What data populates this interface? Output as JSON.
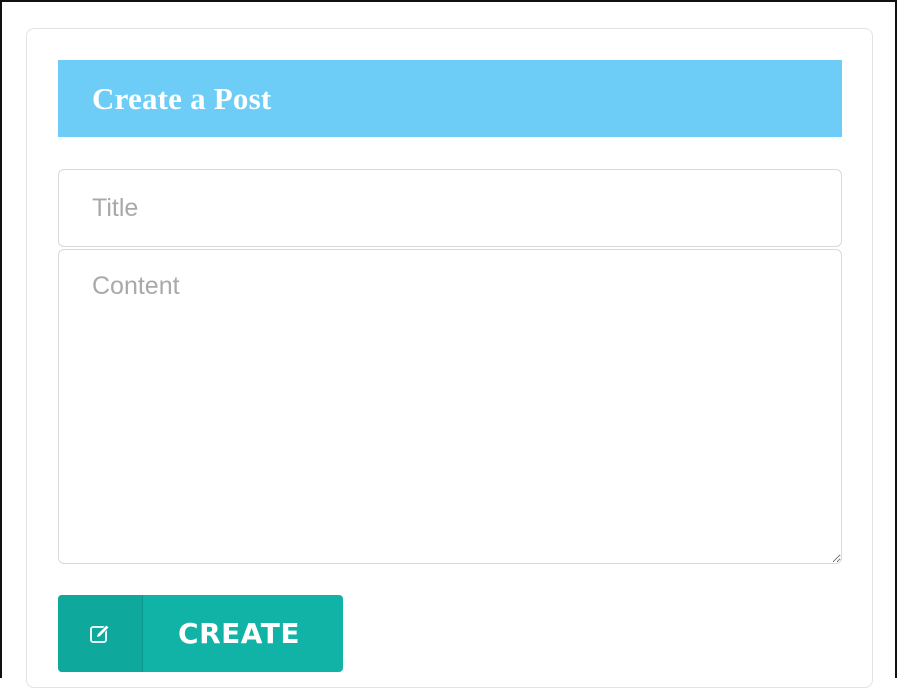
{
  "form": {
    "heading": "Create a Post",
    "title_field": {
      "placeholder": "Title",
      "value": ""
    },
    "content_field": {
      "placeholder": "Content",
      "value": ""
    },
    "submit": {
      "label": "CREATE",
      "icon": "edit-icon"
    }
  },
  "colors": {
    "header_bg": "#6dcdf6",
    "button_bg": "#10b3a6",
    "button_icon_bg": "#0ea89c",
    "placeholder": "#a9a9a9",
    "field_border": "#d9d9d9"
  }
}
